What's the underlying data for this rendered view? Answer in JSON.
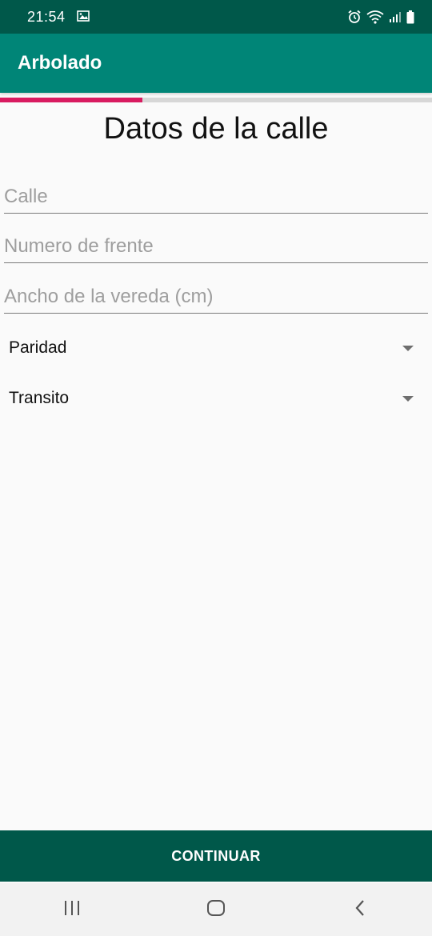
{
  "status_bar": {
    "time": "21:54",
    "icons": [
      "image-icon",
      "alarm-icon",
      "wifi-icon",
      "signal-icon",
      "battery-icon"
    ]
  },
  "app_bar": {
    "title": "Arbolado"
  },
  "progress": {
    "fraction": 0.33,
    "fill_color": "#d81b60",
    "track_color": "#d7d7d7"
  },
  "form": {
    "title": "Datos de la calle",
    "fields": [
      {
        "placeholder": "Calle",
        "value": ""
      },
      {
        "placeholder": "Numero de frente",
        "value": ""
      },
      {
        "placeholder": "Ancho de la vereda (cm)",
        "value": ""
      }
    ],
    "spinners": [
      {
        "selected": "Paridad"
      },
      {
        "selected": "Transito"
      }
    ]
  },
  "actions": {
    "continue_label": "CONTINUAR"
  },
  "nav_bar": {
    "buttons": [
      "recents-icon",
      "home-icon",
      "back-icon"
    ]
  },
  "colors": {
    "status_bar": "#00584a",
    "app_bar": "#008577",
    "accent": "#d81b60",
    "button": "#00584a"
  }
}
